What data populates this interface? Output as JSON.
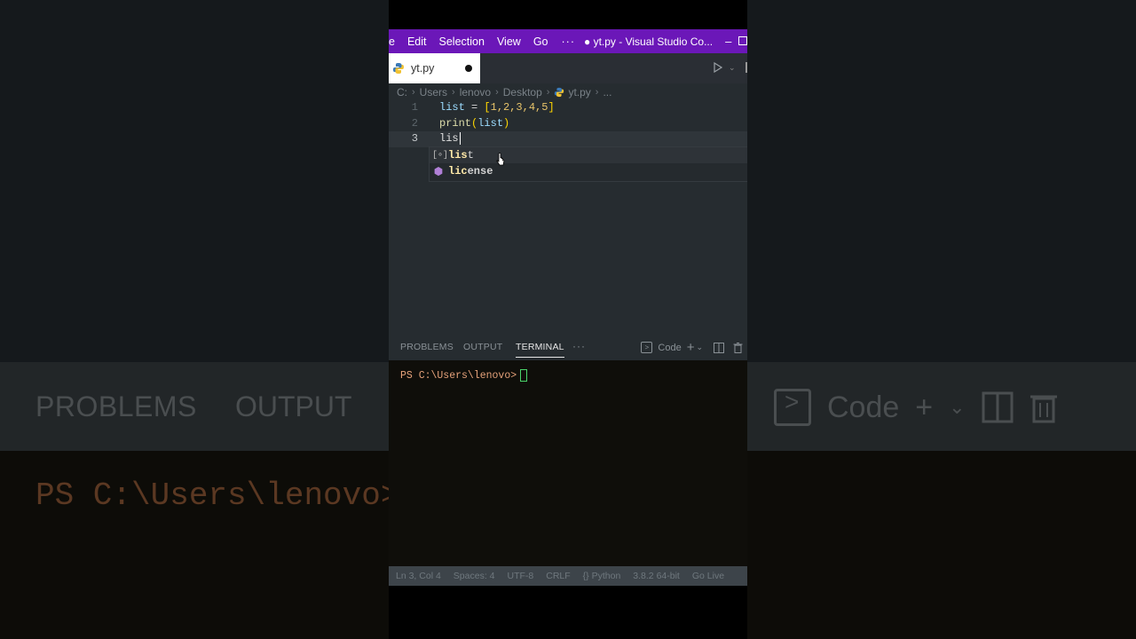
{
  "background": {
    "problems": "PROBLEMS",
    "output": "OUTPUT",
    "prompt": "PS C:\\Users\\lenovo>",
    "code_label": "Code"
  },
  "titlebar": {
    "menu": [
      "e",
      "Edit",
      "Selection",
      "View",
      "Go"
    ],
    "more": "···",
    "title": "● yt.py - Visual Studio Co...",
    "minimize": "–"
  },
  "tab": {
    "filename": "yt.py"
  },
  "breadcrumb": {
    "parts": [
      "C:",
      "Users",
      "lenovo",
      "Desktop",
      "yt.py",
      "..."
    ]
  },
  "editor": {
    "lines": [
      {
        "num": "1",
        "tokens": {
          "a": "list",
          "b": " = ",
          "c": "[",
          "d": "1,2,3,4,5",
          "e": "]"
        }
      },
      {
        "num": "2",
        "tokens": {
          "a": "print",
          "b": "(",
          "c": "list",
          "d": ")"
        }
      },
      {
        "num": "3",
        "text": "lis"
      }
    ]
  },
  "suggestions": [
    {
      "icon": "variable-icon",
      "match": "lis",
      "rest": "t"
    },
    {
      "icon": "module-icon",
      "match": "lic",
      "rest": "ense"
    }
  ],
  "panel": {
    "tabs": [
      "PROBLEMS",
      "OUTPUT",
      "TERMINAL"
    ],
    "active_tab": "TERMINAL",
    "more": "···",
    "shell_label": "Code",
    "terminal_prompt": "PS C:\\Users\\lenovo>"
  },
  "statusbar": {
    "items": [
      "Ln 3, Col 4",
      "Spaces: 4",
      "UTF-8",
      "CRLF",
      "{} Python",
      "3.8.2 64-bit",
      "Go Live"
    ]
  },
  "colors": {
    "titlebar": "#6b17b8",
    "editor_bg": "#262c30",
    "terminal_bg": "#0f0e0a",
    "prompt": "#e5a27a"
  }
}
